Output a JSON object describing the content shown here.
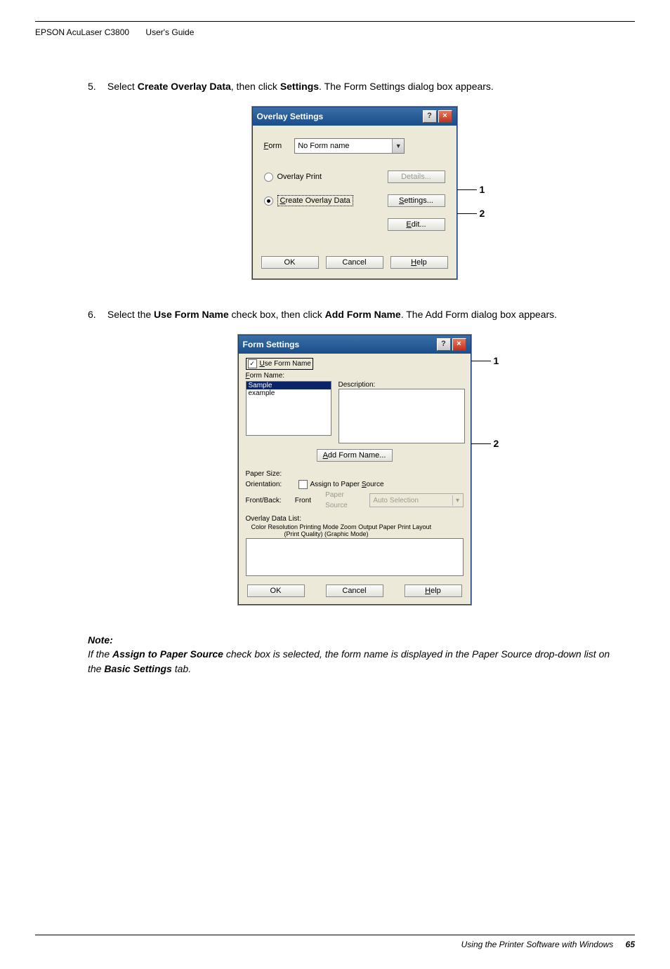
{
  "header": {
    "title": "EPSON AcuLaser C3800",
    "subtitle": "User's Guide"
  },
  "step5": {
    "number": "5.",
    "prefix": "Select ",
    "bold1": "Create Overlay Data",
    "mid": ", then click ",
    "bold2": "Settings",
    "suffix": ". The Form Settings dialog box appears."
  },
  "dialog1": {
    "title": "Overlay Settings",
    "help_icon": "?",
    "close_icon": "×",
    "form_label_prefix": "F",
    "form_label_rest": "orm",
    "form_value": "No Form name",
    "overlay_print": "Overlay Print",
    "details_btn": "Details...",
    "create_overlay_prefix": "C",
    "create_overlay_rest": "reate Overlay Data",
    "settings_btn_prefix": "S",
    "settings_btn_rest": "ettings...",
    "edit_btn_prefix": "E",
    "edit_btn_rest": "dit...",
    "ok": "OK",
    "cancel": "Cancel",
    "help_prefix": "H",
    "help_rest": "elp",
    "callout1": "1",
    "callout2": "2"
  },
  "step6": {
    "number": "6.",
    "prefix": "Select the ",
    "bold1": "Use Form Name",
    "mid": " check box, then click ",
    "bold2": "Add Form Name",
    "suffix": ". The Add Form dialog box appears."
  },
  "dialog2": {
    "title": "Form Settings",
    "help_icon": "?",
    "close_icon": "×",
    "use_form_prefix": "U",
    "use_form_rest": "se Form Name",
    "form_name_prefix": "F",
    "form_name_rest": "orm Name:",
    "list_item1": "Sample",
    "list_item2": "example",
    "description": "Description:",
    "add_form_prefix": "A",
    "add_form_rest": "dd Form Name...",
    "paper_size": "Paper Size:",
    "orientation": "Orientation:",
    "assign_prefix": "Assign to Paper ",
    "assign_u": "S",
    "assign_rest": "ource",
    "front_back_k": "Front/Back:",
    "front_back_v": "Front",
    "paper_source": "Paper Source",
    "auto_selection": "Auto Selection",
    "odl": "Overlay Data List:",
    "odl_head": "Color Resolution   Printing Mode       Zoom   Output Paper             Print Layout",
    "odl_sub": "(Print Quality) (Graphic Mode)",
    "ok": "OK",
    "cancel": "Cancel",
    "help_prefix": "H",
    "help_rest": "elp",
    "check_mark": "✓",
    "callout1": "1",
    "callout2": "2"
  },
  "note": {
    "head": "Note:",
    "p1a": "If the ",
    "p1b": "Assign to Paper Source",
    "p1c": " check box is selected, the form name is displayed in the Paper Source drop-down list on the ",
    "p1d": "Basic Settings",
    "p1e": " tab."
  },
  "footer": {
    "text": "Using the Printer Software with Windows",
    "page": "65"
  }
}
